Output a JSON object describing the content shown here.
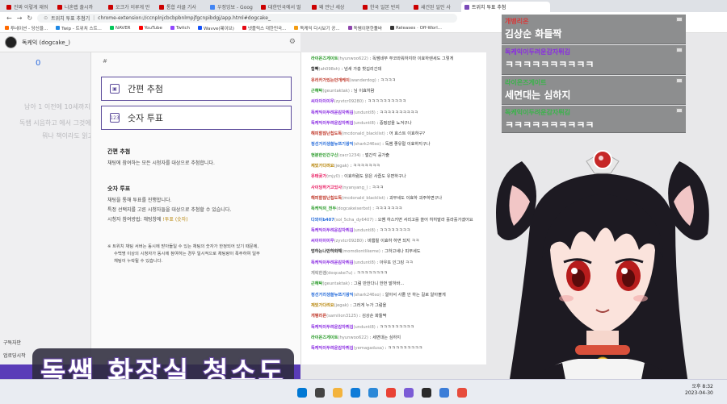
{
  "browser": {
    "tabs": [
      {
        "label": "진짜 이렇게 재워",
        "color": "#cc0000"
      },
      {
        "label": "나혼렙 출시까",
        "color": "#cc0000"
      },
      {
        "label": "오크가 이루게 만",
        "color": "#cc0000"
      },
      {
        "label": "통합 라클 기사",
        "color": "#cc0000"
      },
      {
        "label": "우정잉보 - Goog",
        "color": "#4285f4"
      },
      {
        "label": "대한민국에서 멀",
        "color": "#cc0000"
      },
      {
        "label": "왜 만난 세상",
        "color": "#cc0000"
      },
      {
        "label": "한국 일본 반지",
        "color": "#cc0000"
      },
      {
        "label": "새건된 일인 사",
        "color": "#cc0000"
      },
      {
        "label": "트위치 투표 추첨",
        "color": "#7a4ab8"
      }
    ],
    "active_tab": "트위치 투표 추첨기",
    "url": "chrome-extension://ccnplnjcbcbpbnlmpjfgcnpibdgj/app.html#dogcake_",
    "bookmarks": [
      "투네이션 - 당신을...",
      "Twip - 트위치 스트...",
      "NAVER",
      "YouTube",
      "Twitch",
      "Wavve(웨이브)",
      "넷플릭스 대한민국...",
      "독케익 다시보기 공...",
      "독쌤이편한툴바",
      "Releases · Off-Worl..."
    ]
  },
  "app": {
    "channel": "독케익 (dogcake_)",
    "viewer_count": "0",
    "hash": "#",
    "ghost_lines": [
      "남아 1 이전에 10세까지 이의 아름",
      "독쌤 시음하고 에서 그것에 대해 분",
      "뭐나 책이라도 읽고 배우"
    ],
    "side_items": [
      "구독자만",
      "업로딩시작"
    ],
    "buttons": {
      "easy": "간편 추첨",
      "number": "숫자 투표"
    },
    "easy_title": "간편 추첨",
    "easy_desc": "채팅에 참여하는 모든 시청자를 대상으로 추첨합니다.",
    "number_title": "숫자 투표",
    "number_desc1": "채팅을 통해 투표를 진행합니다.",
    "number_desc2": "특정 선택지를 고른 시청자들을 대상으로 추첨할 수 있습니다.",
    "number_desc3_pre": "시청자 참여방법: 채팅창에 ",
    "number_desc3_hl": "!투표 (숫자)",
    "note1": "※ 트위치 채팅 서버는 동시에 받아들일 수 있는 채팅의 숫자가 한정되어 있기 때문에,",
    "note2": "수백명 이상의 시청자가 동시에 참여하는 경우 일시적으로 채팅량이 폭주하여 일부",
    "note3": "채팅이 누락될 수 있습니다."
  },
  "chat": [
    {
      "name": "라이온즈게이트",
      "id": "(hyunwoo622)",
      "text": "독쌤네쭈 쭈코와워하지마 이효하렌세도 그렇게",
      "color": "#2c9c2c"
    },
    {
      "name": "함빡",
      "id": "(ah098sh)",
      "text": "넘새 가층 핫깁리긴데",
      "color": "#333333"
    },
    {
      "name": "유리카가있는안개케이",
      "id": "(wanderdog)",
      "text": "ㅋㅋㅋㅋ",
      "color": "#c0392b"
    },
    {
      "name": "근혜탁",
      "id": "(geuntaktak)",
      "text": "님 이효하람",
      "color": "#2c9c2c"
    },
    {
      "name": "씨이이이이우",
      "id": "(zyvtcr09280)",
      "text": "ㅋㅋㅋㅋㅋㅋㅋㅋㅋㅋ",
      "color": "#8a2be2"
    },
    {
      "name": "독케익이두려운감자튀김",
      "id": "(unduntl8)",
      "text": "ㅋㅋㅋㅋㅋㅋㅋㅋㅋㅋ",
      "color": "#8a2be2"
    },
    {
      "name": "독케익이두려운감자튀김",
      "id": "(unduntl8)",
      "text": "중핑감을 뇨겨구나",
      "color": "#8a2be2"
    },
    {
      "name": "해피할잖난칩도독",
      "id": "(mcdonald_blacklist)",
      "text": "어 효스트 이효하구?",
      "color": "#c0392b"
    },
    {
      "name": "정선거리생쓸뉴쯔기왕익",
      "id": "(shark246so)",
      "text": "독쌤 좋유절 이효하지구나",
      "color": "#2a6fdb"
    },
    {
      "name": "현분한인간구신",
      "id": "(cacr1234)",
      "text": "벌간각 공가출",
      "color": "#2c9c2c"
    },
    {
      "name": "재밌가다려요",
      "id": "(jegak)",
      "text": "ㅋㅋㅋㅋㅋㅋㅋ",
      "color": "#b8860b"
    },
    {
      "name": "유태곶가",
      "id": "(mjy0)",
      "text": "이효하렴도 읽은 사줍도 유면하구나",
      "color": "#e91e63"
    },
    {
      "name": "사이딩하거고있사",
      "id": "(nyanyang_)",
      "text": "ㅋㅋㅋ",
      "color": "#e91e63"
    },
    {
      "name": "해피할잖난칩도독",
      "id": "(mcdonald_blacklist)",
      "text": "괴부세도 이효하 괴주하면구나",
      "color": "#c0392b"
    },
    {
      "name": "독케익의_전두",
      "id": "(dogcakeiserbst)",
      "text": "ㅋㅋㅋㅋㅋㅋㅋ",
      "color": "#2c9c2c"
    },
    {
      "name": "다와이b407",
      "id": "(sol_5cha_dy6407)",
      "text": "오쌤 하스키면 서리고를 쏠어 히히발라 흘라흘가겠어요",
      "color": "#2a6fdb"
    },
    {
      "name": "독케익이두려운감자튀김",
      "id": "(unduntl8)",
      "text": "ㅋㅋㅋㅋㅋㅋㅋㅋ",
      "color": "#8a2be2"
    },
    {
      "name": "씨이이이이우",
      "id": "(zyvtcr09280)",
      "text": "바쁨될 이효하 하면 되지 ㅋㅋ",
      "color": "#8a2be2"
    },
    {
      "name": "멍하는나만하화해",
      "id": "(momdiontlikeme)",
      "text": "그하고새나 피부세도",
      "color": "#333333"
    },
    {
      "name": "독케익이두려운감자튀김",
      "id": "(unduntl8)",
      "text": "아우또 인그킹 ㅋㅋ",
      "color": "#8a2be2"
    },
    {
      "name": "게릭한겜",
      "id": "(doqcake7u)",
      "text": "ㅋㅋㅋㅋㅋㅋㅋㅋ",
      "color": "#999999"
    },
    {
      "name": "근혜탁",
      "id": "(geuntaktak)",
      "text": "그럼 만한다니 한번 발하바...",
      "color": "#2c9c2c"
    },
    {
      "name": "정선거리생쓸뉴쯔기왕익",
      "id": "(shark246so)",
      "text": "알아서 사줄 안 하는 길로 알아볼게",
      "color": "#2a6fdb"
    },
    {
      "name": "재밌가다려요",
      "id": "(jegak)",
      "text": "그러게 누가 그럼을",
      "color": "#b8860b"
    },
    {
      "name": "개뱅리온",
      "id": "(samilion3125)",
      "text": "김상순 화들짝",
      "color": "#c0392b"
    },
    {
      "name": "독케익이두려운감자튀김",
      "id": "(unduntl8)",
      "text": "ㅋㅋㅋㅋㅋㅋㅋㅋㅋ",
      "color": "#8a2be2"
    },
    {
      "name": "라이온즈게이트",
      "id": "(hyunwoo622)",
      "text": "세면대는 심하지",
      "color": "#2c9c2c"
    },
    {
      "name": "독케익이두려운감자튀김",
      "id": "(yemagadusa)",
      "text": "ㅋㅋㅋㅋㅋㅋㅋㅋㅋ",
      "color": "#8a2be2"
    }
  ],
  "overlay": [
    {
      "name": "개뱅리온",
      "text": "김상순 화들짝",
      "name_color": "#d63a3a"
    },
    {
      "name": "독케익이두려운감자튀김",
      "text": "ㅋㅋㅋㅋㅋㅋㅋㅋㅋㅋ",
      "name_color": "#8a2be2"
    },
    {
      "name": "라이온즈게이트",
      "text": "세면대는 심하지",
      "name_color": "#3ab44a"
    },
    {
      "name": "독케익이두려운감자튀김",
      "text": "ㅋㅋㅋㅋㅋㅋㅋㅋㅋㅋ",
      "name_color": "#3ab44a"
    }
  ],
  "caption": "독쌤 화장실 청소도",
  "clock": {
    "time": "오후 8:32",
    "date": "2023-04-30"
  },
  "colors": {
    "accent": "#5c4b9b",
    "caption_stroke": "#6b4ca8"
  }
}
